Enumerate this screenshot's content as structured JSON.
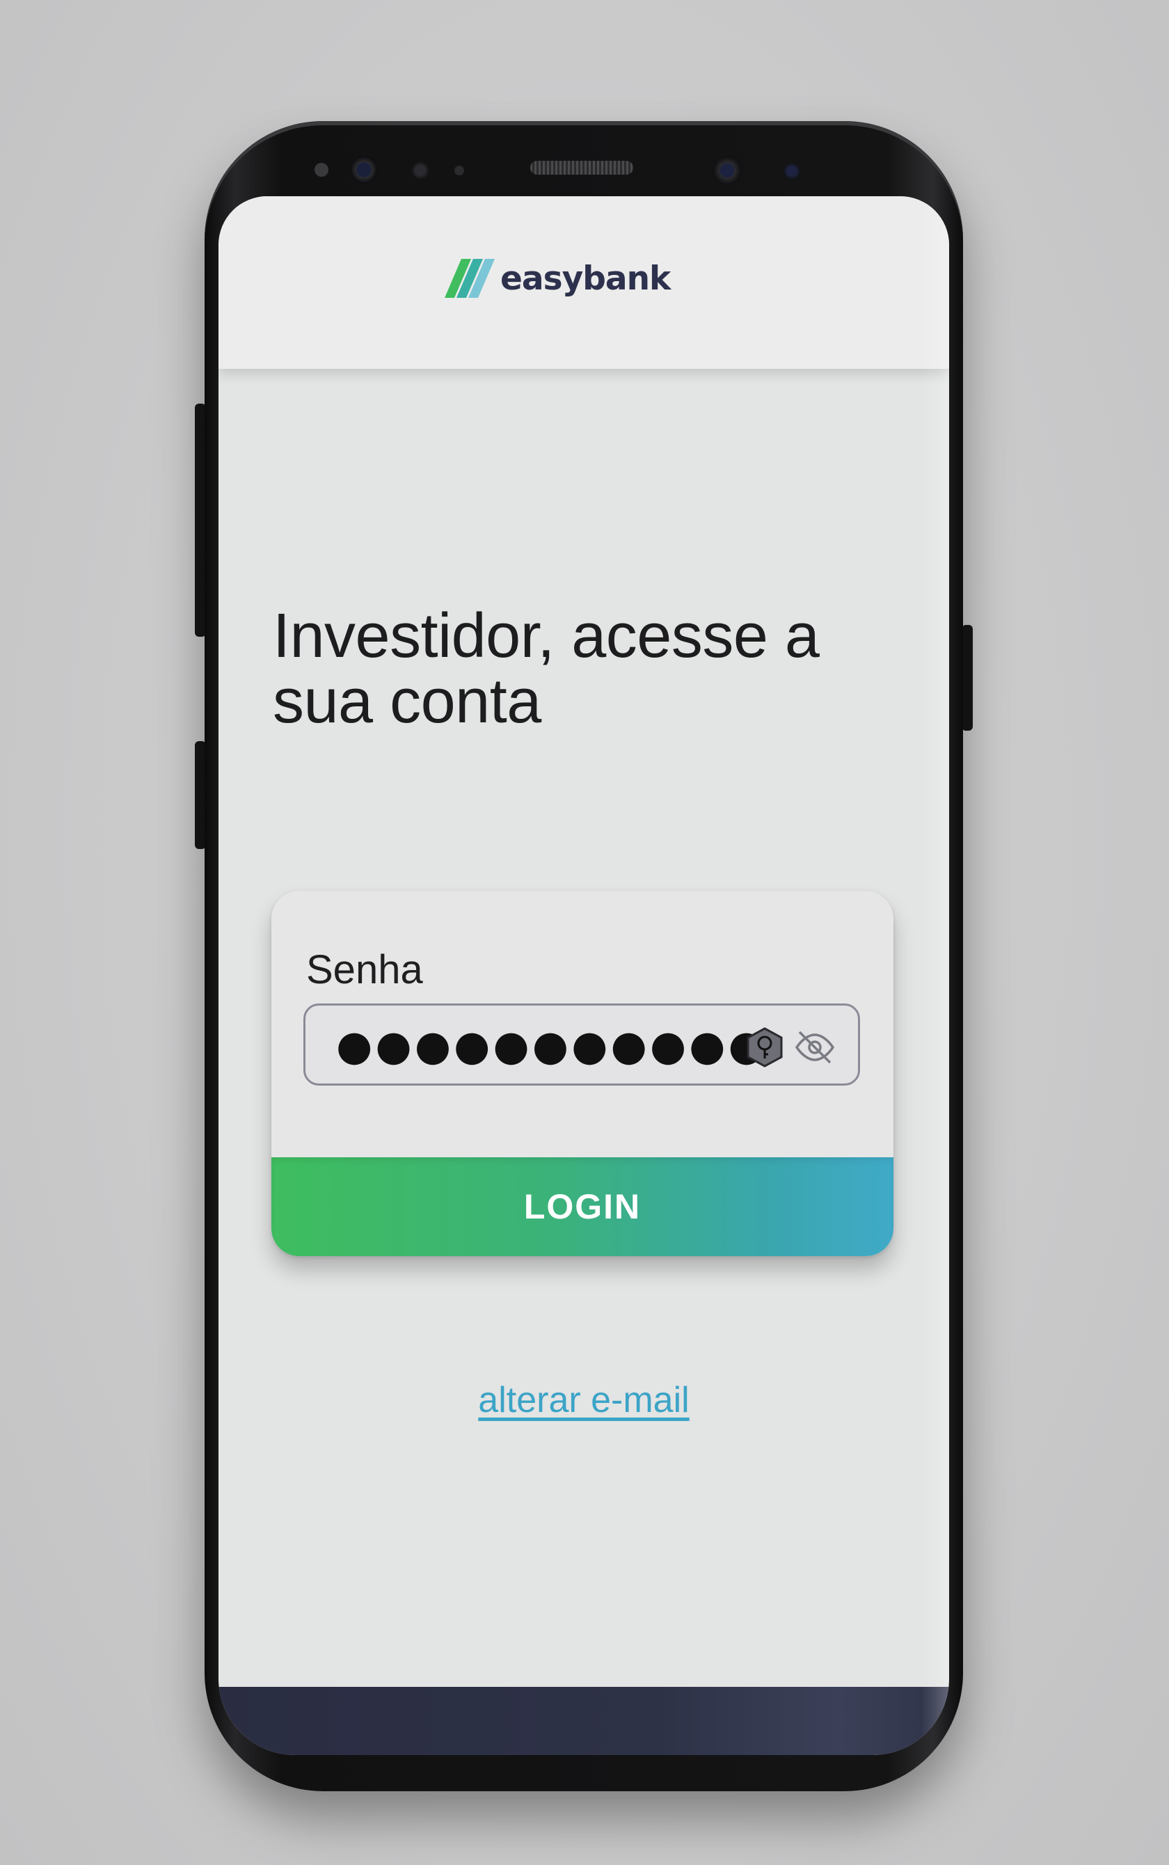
{
  "brand": {
    "name": "easybank",
    "logo_icon": "diagonal-stripes-logo",
    "colors": {
      "stripe_1": "#3fbd5f",
      "stripe_2": "#3ab0a5",
      "stripe_3": "#7ac6d6",
      "text": "#2d314d"
    }
  },
  "main": {
    "heading": "Investidor, acesse a sua conta"
  },
  "login_form": {
    "password_label": "Senha",
    "password_value": "●●●●●●●●●●●",
    "password_manager_icon": "key-icon",
    "toggle_visibility_icon": "eye-slash-icon",
    "submit_label": "LOGIN",
    "submit_gradient": [
      "#3fbd5f",
      "#40aac8"
    ]
  },
  "footer_link": {
    "label": "alterar e-mail",
    "color": "#3ba4c7"
  },
  "bottom_bar": {
    "color": "#2a2d42"
  }
}
